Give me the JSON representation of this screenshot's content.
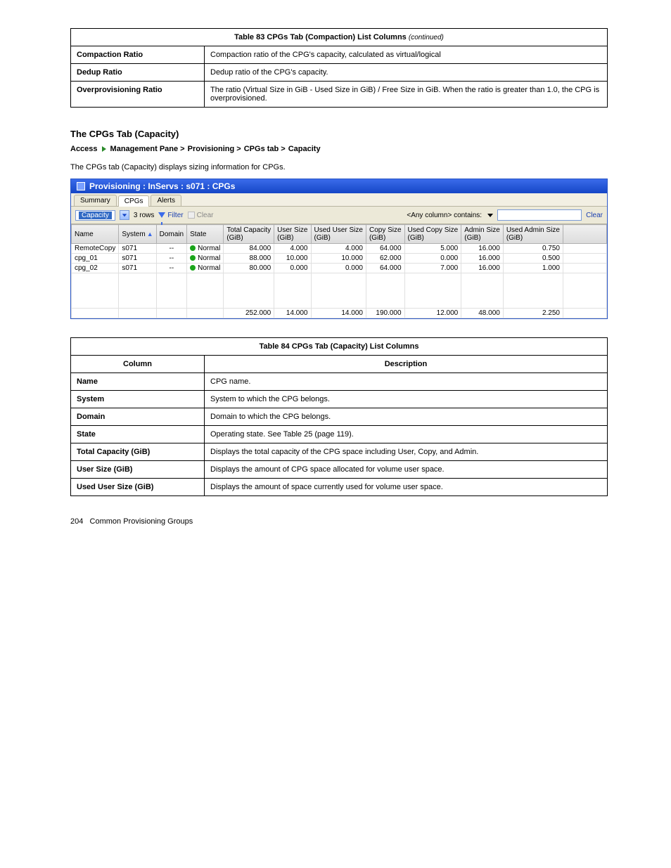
{
  "table1": {
    "header": "Table 83 CPGs Tab (Compaction) List Columns",
    "cont": "(continued)",
    "rows": [
      {
        "col": "Compaction Ratio",
        "desc": "Compaction ratio of the CPG's capacity, calculated as virtual/logical"
      },
      {
        "col": "Dedup Ratio",
        "desc": "Dedup ratio of the CPG's capacity."
      },
      {
        "col": "Overprovisioning Ratio",
        "desc": "The ratio (Virtual Size in GiB - Used Size in GiB) / Free Size in GiB. When the ratio is greater than 1.0, the CPG is overprovisioned."
      }
    ]
  },
  "section": {
    "heading": "The CPGs Tab (Capacity)",
    "breadcrumb": [
      "Access",
      "Management Pane",
      "Provisioning",
      "CPGs tab",
      "Capacity"
    ],
    "description": "The CPGs tab (Capacity) displays sizing information for CPGs."
  },
  "app": {
    "title": "Provisioning : InServs : s071 : CPGs",
    "tabs": [
      "Summary",
      "CPGs",
      "Alerts"
    ],
    "active_tab": 1,
    "toolbar": {
      "view_dropdown": "Capacity",
      "rows_label": "3 rows",
      "filter": "Filter",
      "clear_toolbar": "Clear",
      "filter_scope": "<Any column> contains:",
      "clear_right": "Clear"
    },
    "columns": [
      "Name",
      "System",
      "Domain",
      "State",
      "Total Capacity (GiB)",
      "User Size (GiB)",
      "Used User Size (GiB)",
      "Copy Size (GiB)",
      "Used Copy Size (GiB)",
      "Admin Size (GiB)",
      "Used Admin Size (GiB)"
    ],
    "sort_column_index": 1,
    "rows": [
      {
        "name": "RemoteCopy",
        "system": "s071",
        "domain": "--",
        "state": "Normal",
        "total": "84.000",
        "user": "4.000",
        "used_user": "4.000",
        "copy": "64.000",
        "used_copy": "5.000",
        "admin": "16.000",
        "used_admin": "0.750"
      },
      {
        "name": "cpg_01",
        "system": "s071",
        "domain": "--",
        "state": "Normal",
        "total": "88.000",
        "user": "10.000",
        "used_user": "10.000",
        "copy": "62.000",
        "used_copy": "0.000",
        "admin": "16.000",
        "used_admin": "0.500"
      },
      {
        "name": "cpg_02",
        "system": "s071",
        "domain": "--",
        "state": "Normal",
        "total": "80.000",
        "user": "0.000",
        "used_user": "0.000",
        "copy": "64.000",
        "used_copy": "7.000",
        "admin": "16.000",
        "used_admin": "1.000"
      }
    ],
    "totals": {
      "total": "252.000",
      "user": "14.000",
      "used_user": "14.000",
      "copy": "190.000",
      "used_copy": "12.000",
      "admin": "48.000",
      "used_admin": "2.250"
    }
  },
  "table2": {
    "header": "Table 84 CPGs Tab (Capacity) List Columns",
    "col_hdr": "Column",
    "desc_hdr": "Description",
    "rows": [
      {
        "col": "Name",
        "desc": "CPG name."
      },
      {
        "col": "System",
        "desc": "System to which the CPG belongs."
      },
      {
        "col": "Domain",
        "desc": "Domain to which the CPG belongs."
      },
      {
        "col": "State",
        "desc": "Operating state. See Table 25 (page 119)."
      },
      {
        "col": "Total Capacity (GiB)",
        "desc": "Displays the total capacity of the CPG space including User, Copy, and Admin."
      },
      {
        "col": "User Size (GiB)",
        "desc": "Displays the amount of CPG space allocated for volume user space."
      },
      {
        "col": "Used User Size (GiB)",
        "desc": "Displays the amount of space currently used for volume user space."
      }
    ]
  },
  "footer": {
    "page": "204",
    "text": "Common Provisioning Groups"
  }
}
